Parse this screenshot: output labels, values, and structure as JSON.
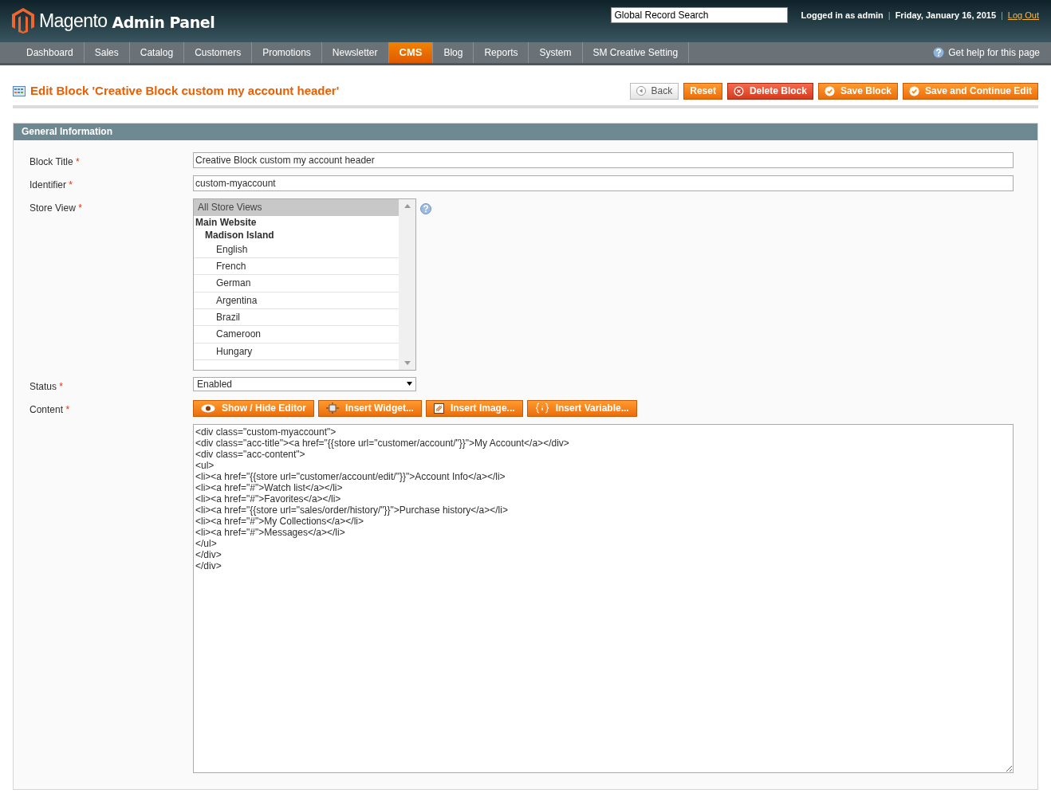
{
  "header": {
    "logo_word": "Magento",
    "logo_sub": "Admin Panel",
    "search": {
      "value": "Global Record Search"
    },
    "user": "Logged in as admin",
    "date": "Friday, January 16, 2015",
    "logout": "Log Out",
    "separators": [
      "|",
      "|"
    ]
  },
  "nav": [
    {
      "label": "Dashboard",
      "selected": false
    },
    {
      "label": "Sales",
      "selected": false
    },
    {
      "label": "Catalog",
      "selected": false
    },
    {
      "label": "Customers",
      "selected": false
    },
    {
      "label": "Promotions",
      "selected": false
    },
    {
      "label": "Newsletter",
      "selected": false
    },
    {
      "label": "CMS",
      "selected": true
    },
    {
      "label": "Blog",
      "selected": false
    },
    {
      "label": "Reports",
      "selected": false
    },
    {
      "label": "System",
      "selected": false
    },
    {
      "label": "SM Creative Setting",
      "selected": false
    }
  ],
  "help": "Get help for this page",
  "page_title": "Edit Block 'Creative Block custom my account header'",
  "actions": [
    {
      "label": "Back",
      "kind": "back"
    },
    {
      "label": "Reset",
      "kind": "plain"
    },
    {
      "label": "Delete Block",
      "kind": "delete"
    },
    {
      "label": "Save Block",
      "kind": "save"
    },
    {
      "label": "Save and Continue Edit",
      "kind": "save"
    }
  ],
  "section": {
    "title": "General Information",
    "block_title": {
      "label": "Block Title",
      "required_mark": "*",
      "value": "Creative Block custom my account header"
    },
    "identifier": {
      "label": "Identifier",
      "required_mark": "*",
      "value": "custom-myaccount"
    },
    "store_view": {
      "label": "Store View",
      "required_mark": "*",
      "options": [
        {
          "label": "All Store Views",
          "kind": "option",
          "selected": true
        },
        {
          "label": "Main Website",
          "kind": "group",
          "children": [
            {
              "label": "Madison Island",
              "kind": "group",
              "children": [
                {
                  "label": "English",
                  "kind": "option",
                  "selected": false
                },
                {
                  "label": "French",
                  "kind": "option",
                  "selected": false
                },
                {
                  "label": "German",
                  "kind": "option",
                  "selected": false
                },
                {
                  "label": "Argentina",
                  "kind": "option",
                  "selected": false
                },
                {
                  "label": "Brazil",
                  "kind": "option",
                  "selected": false
                },
                {
                  "label": "Cameroon",
                  "kind": "option",
                  "selected": false
                },
                {
                  "label": "Hungary",
                  "kind": "option",
                  "selected": false
                }
              ]
            }
          ]
        }
      ]
    },
    "status": {
      "label": "Status",
      "required_mark": "*",
      "value": "Enabled"
    },
    "content": {
      "label": "Content",
      "required_mark": "*",
      "buttons": [
        {
          "label": "Show / Hide Editor",
          "kind": "eye"
        },
        {
          "label": "Insert Widget...",
          "kind": "widget"
        },
        {
          "label": "Insert Image...",
          "kind": "image"
        },
        {
          "label": "Insert Variable...",
          "kind": "variable"
        }
      ],
      "value": "<div class=\"custom-myaccount\">\n<div class=\"acc-title\"><a href=\"{{store url=\"customer/account/\"}}\">My Account</a></div>\n<div class=\"acc-content\">\n<ul>\n<li><a href=\"{{store url=\"customer/account/edit/\"}}\">Account Info</a></li>\n<li><a href=\"#\">Watch list</a></li>\n<li><a href=\"#\">Favorites</a></li>\n<li><a href=\"{{store url=\"sales/order/history/\"}}\">Purchase history</a></li>\n<li><a href=\"#\">My Collections</a></li>\n<li><a href=\"#\">Messages</a></li>\n</ul>\n</div>\n</div>"
    }
  }
}
